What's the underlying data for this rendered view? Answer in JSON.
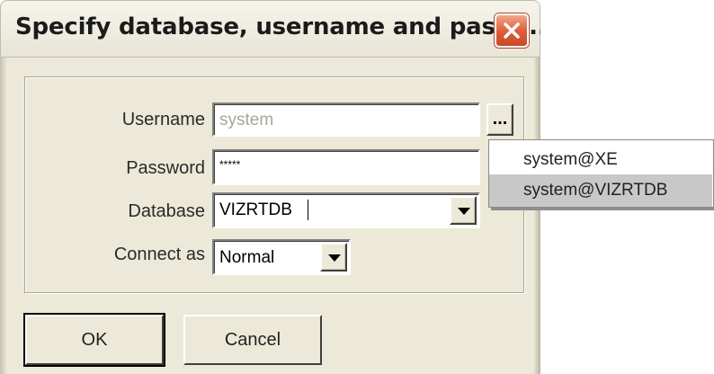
{
  "window": {
    "title": "Specify database, username and passw...",
    "close_icon": "close-x-icon"
  },
  "form": {
    "username": {
      "label": "Username",
      "value": "system",
      "browse_label": "..."
    },
    "password": {
      "label": "Password",
      "value": "*****"
    },
    "database": {
      "label": "Database",
      "value": "VIZRTDB"
    },
    "connect_as": {
      "label": "Connect as",
      "value": "Normal"
    }
  },
  "popup": {
    "items": [
      "system@XE",
      "system@VIZRTDB"
    ],
    "selected_index": 1
  },
  "buttons": {
    "ok": "OK",
    "cancel": "Cancel"
  },
  "colors": {
    "dialog_bg": "#ece9d8",
    "close_button": "#dc5a38",
    "popup_selected": "#c8c8c8"
  }
}
